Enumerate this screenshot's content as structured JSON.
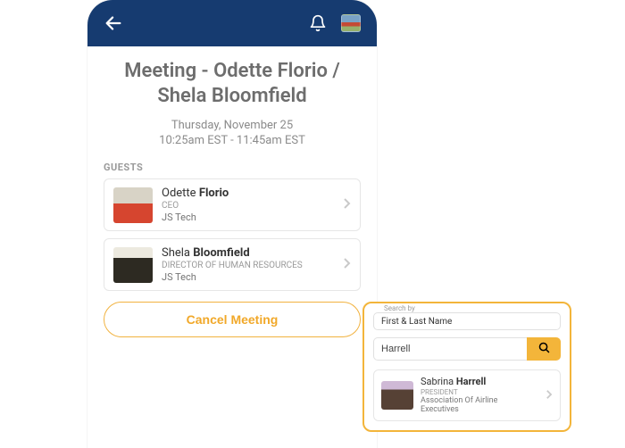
{
  "meeting": {
    "title": "Meeting - Odette Florio / Shela Bloomfield",
    "date": "Thursday, November 25",
    "time": "10:25am EST - 11:45am EST",
    "guests_label": "GUESTS",
    "cancel_label": "Cancel Meeting"
  },
  "guests": [
    {
      "first": "Odette",
      "last": "Florio",
      "title": "CEO",
      "company": "JS Tech"
    },
    {
      "first": "Shela",
      "last": "Bloomfield",
      "title": "DIRECTOR OF HUMAN RESOURCES",
      "company": "JS Tech"
    }
  ],
  "search": {
    "field_label": "Search by",
    "mode": "First & Last Name",
    "query": "Harrell",
    "result": {
      "first": "Sabrina",
      "last": "Harrell",
      "title": "PRESIDENT",
      "company": "Association Of Airline Executives"
    }
  }
}
